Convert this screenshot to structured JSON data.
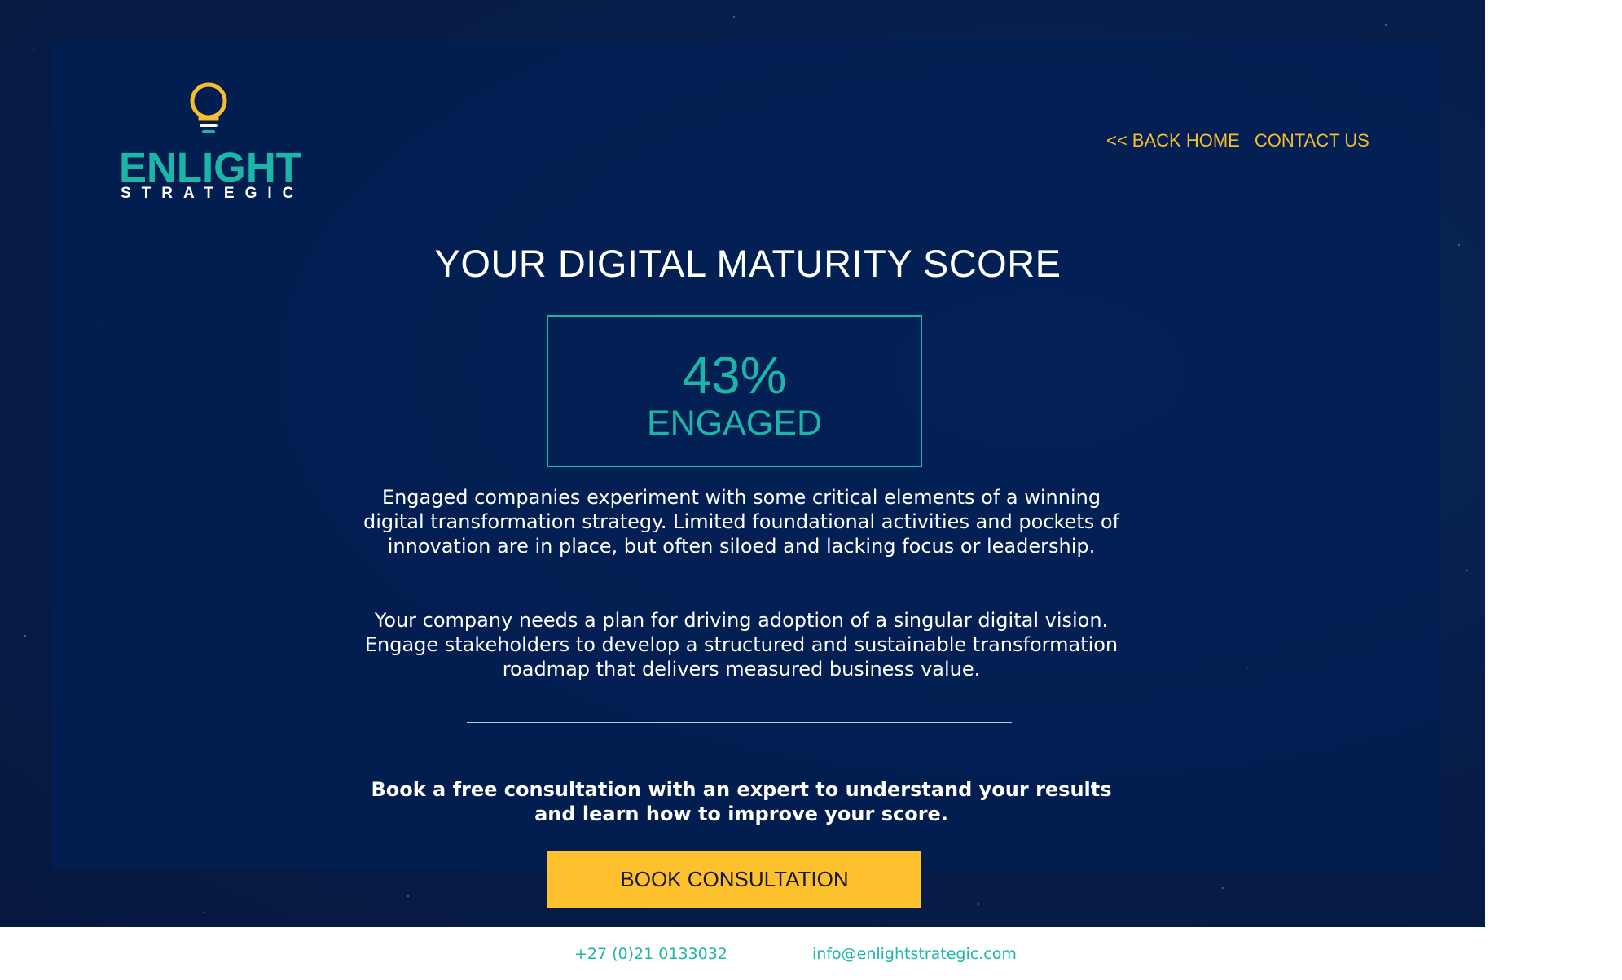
{
  "logo": {
    "brand": "ENLIGHT",
    "sub": "STRATEGIC",
    "icon": "lightbulb-icon"
  },
  "nav": {
    "back_home": "<< BACK HOME",
    "contact_us": "CONTACT US"
  },
  "title": "YOUR DIGITAL MATURITY SCORE",
  "score": {
    "percent": "43%",
    "level": "ENGAGED"
  },
  "description": "Engaged companies experiment with some critical elements of a winning digital transformation strategy. Limited foundational activities and pockets of innovation are in place, but often siloed and lacking focus or leadership.",
  "recommendation": "Your company needs a plan for driving adoption of a singular digital vision. Engage stakeholders to develop a structured and sustainable transformation roadmap that delivers measured business value.",
  "cta": {
    "text": "Book a free consultation with an expert to understand your results and learn how to improve your score.",
    "button": "BOOK CONSULTATION"
  },
  "footer": {
    "phone": "+27 (0)21 0133032",
    "email": "info@enlightstrategic.com"
  },
  "colors": {
    "accent_teal": "#1bb6a7",
    "accent_yellow": "#f6bd2c",
    "button_yellow": "#fdc12d",
    "background_navy": "#021e54"
  }
}
